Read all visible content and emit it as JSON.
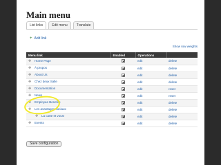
{
  "page": {
    "title": "Main menu"
  },
  "tabs": [
    {
      "label": "List links",
      "active": true
    },
    {
      "label": "Edit menu",
      "active": false
    },
    {
      "label": "Translate",
      "active": false
    }
  ],
  "add_link": "Add link",
  "show_row_weights": "Show row weights",
  "table": {
    "headers": [
      "Menu link",
      "Enabled",
      "Operations"
    ],
    "rows": [
      {
        "title": "Home Page",
        "enabled": true,
        "edit": "edit",
        "op": "delete",
        "indent": 0
      },
      {
        "title": "À propos",
        "enabled": true,
        "edit": "edit",
        "op": "delete",
        "indent": 0
      },
      {
        "title": "About Us",
        "enabled": true,
        "edit": "edit",
        "op": "delete",
        "indent": 0
      },
      {
        "title": "Chez deux Salle",
        "enabled": true,
        "edit": "edit",
        "op": "delete",
        "indent": 0
      },
      {
        "title": "Documentation",
        "enabled": true,
        "edit": "edit",
        "op": "reset",
        "indent": 0
      },
      {
        "title": "News",
        "enabled": true,
        "edit": "edit",
        "op": "reset",
        "indent": 0
      },
      {
        "title": "Employee Benefits",
        "enabled": true,
        "edit": "edit",
        "op": "delete",
        "indent": 0
      },
      {
        "title": "Les avantages sociaux",
        "enabled": true,
        "edit": "edit",
        "op": "delete",
        "indent": 0
      },
      {
        "title": "La carte et vous!",
        "enabled": true,
        "edit": "edit",
        "op": "delete",
        "indent": 1
      },
      {
        "title": "Events",
        "enabled": true,
        "edit": "edit",
        "op": "delete",
        "indent": 0
      }
    ]
  },
  "save_button": "Save configuration",
  "colors": {
    "link": "#1f5ea8",
    "header_bg": "#3a3a3a",
    "highlight": "#f2ea2b",
    "background": "#2b2b2b"
  },
  "icons": {
    "drag": "drag-handle-icon",
    "checkbox": "checkbox-checked-icon"
  }
}
